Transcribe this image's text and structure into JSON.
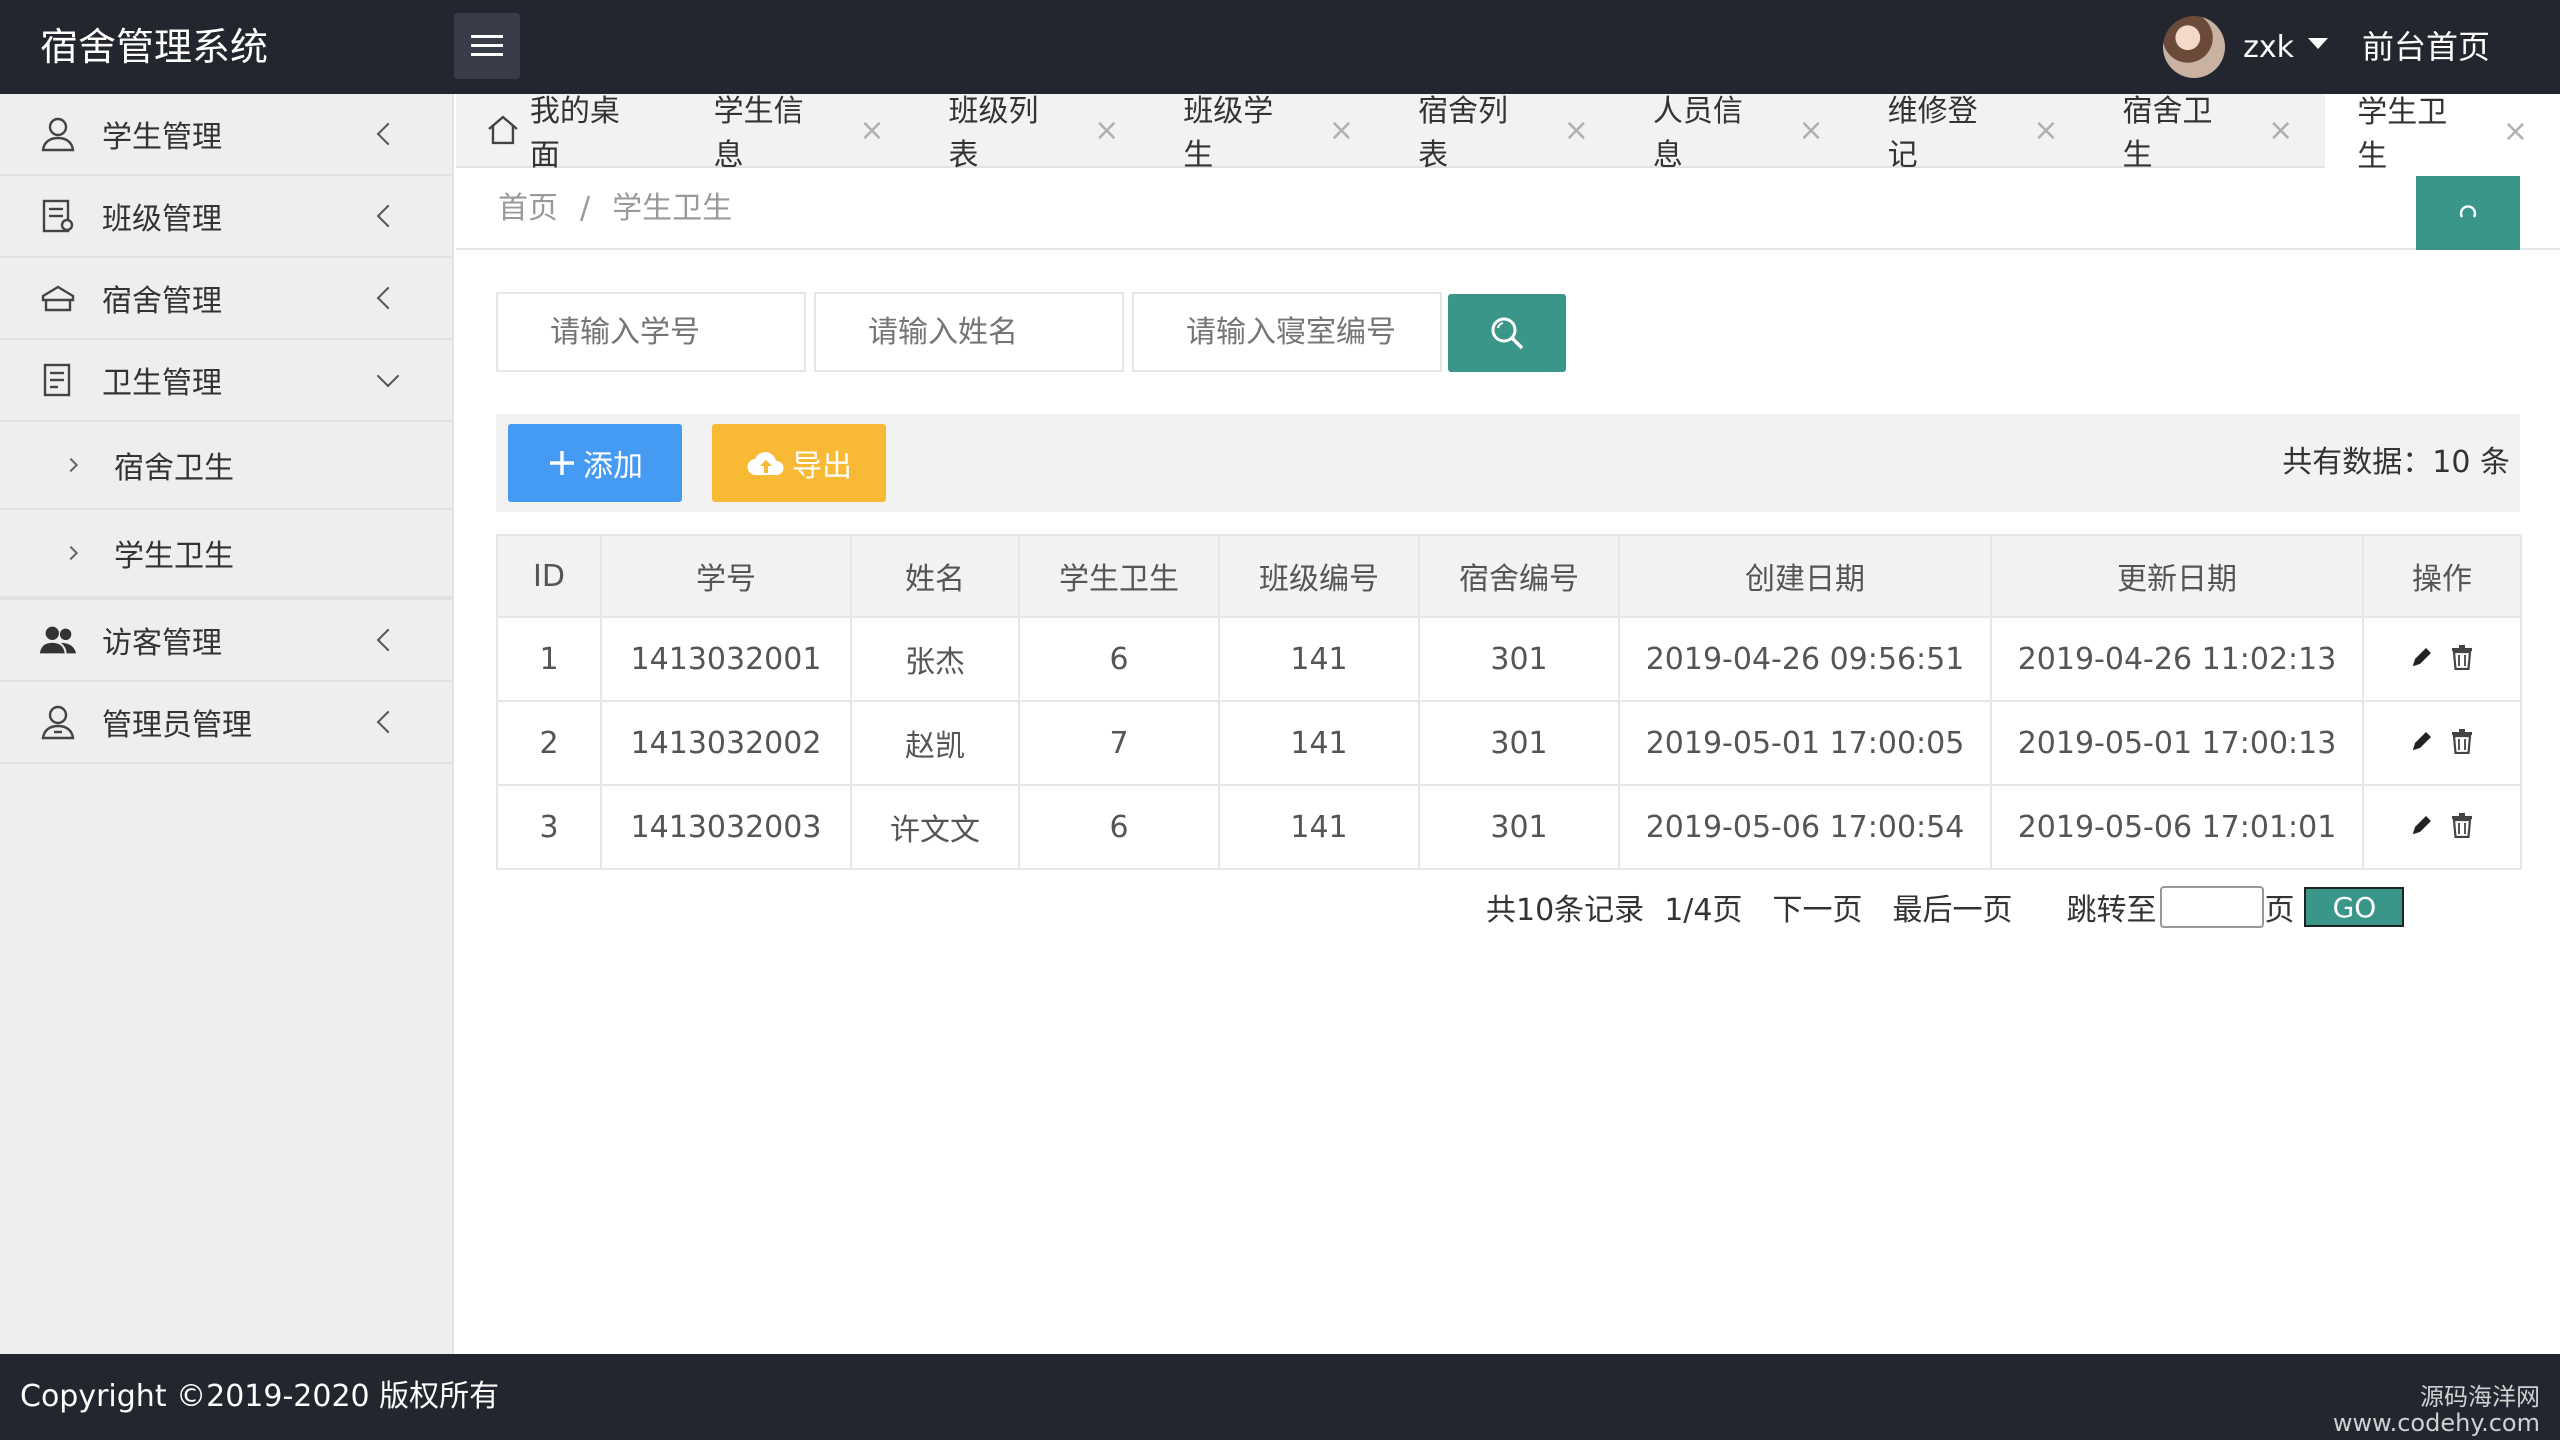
{
  "header": {
    "app_title": "宿舍管理系统",
    "username": "zxk",
    "home_link": "前台首页"
  },
  "sidebar": {
    "items": [
      {
        "label": "学生管理",
        "icon": "user-icon"
      },
      {
        "label": "班级管理",
        "icon": "class-icon"
      },
      {
        "label": "宿舍管理",
        "icon": "dorm-icon"
      },
      {
        "label": "卫生管理",
        "icon": "document-icon",
        "expanded": true
      },
      {
        "label": "访客管理",
        "icon": "visitors-icon"
      },
      {
        "label": "管理员管理",
        "icon": "admin-icon"
      }
    ],
    "sub_items": [
      "宿舍卫生",
      "学生卫生"
    ]
  },
  "tabs": [
    {
      "label": "我的桌面"
    },
    {
      "label": "学生信息"
    },
    {
      "label": "班级列表"
    },
    {
      "label": "班级学生"
    },
    {
      "label": "宿舍列表"
    },
    {
      "label": "人员信息"
    },
    {
      "label": "维修登记"
    },
    {
      "label": "宿舍卫生"
    },
    {
      "label": "学生卫生",
      "active": true
    }
  ],
  "tab_close_glyph": "×",
  "breadcrumb": {
    "home": "首页",
    "sep": "/",
    "current": "学生卫生"
  },
  "search": {
    "student_no_placeholder": "请输入学号",
    "name_placeholder": "请输入姓名",
    "room_no_placeholder": "请输入寝室编号"
  },
  "toolbar": {
    "add_label": "添加",
    "export_label": "导出",
    "total_text": "共有数据：10 条"
  },
  "table": {
    "headers": [
      "ID",
      "学号",
      "姓名",
      "学生卫生",
      "班级编号",
      "宿舍编号",
      "创建日期",
      "更新日期",
      "操作"
    ],
    "rows": [
      [
        "1",
        "1413032001",
        "张杰",
        "6",
        "141",
        "301",
        "2019-04-26 09:56:51",
        "2019-04-26 11:02:13"
      ],
      [
        "2",
        "1413032002",
        "赵凯",
        "7",
        "141",
        "301",
        "2019-05-01 17:00:05",
        "2019-05-01 17:00:13"
      ],
      [
        "3",
        "1413032003",
        "许文文",
        "6",
        "141",
        "301",
        "2019-05-06 17:00:54",
        "2019-05-06 17:01:01"
      ]
    ]
  },
  "pager": {
    "records": "共10条记录",
    "page": "1/4页",
    "next": "下一页",
    "last": "最后一页",
    "jump_label": "跳转至",
    "page_suffix": "页",
    "go": "GO"
  },
  "footer": {
    "copyright": "Copyright ©2019-2020 版权所有",
    "watermark_line1": "源码海洋网",
    "watermark_line2": "www.codehy.com"
  },
  "colors": {
    "header_bg": "#23262e",
    "accent_green": "#3a9689",
    "add_blue": "#459bf4",
    "export_yellow": "#f8b935"
  }
}
